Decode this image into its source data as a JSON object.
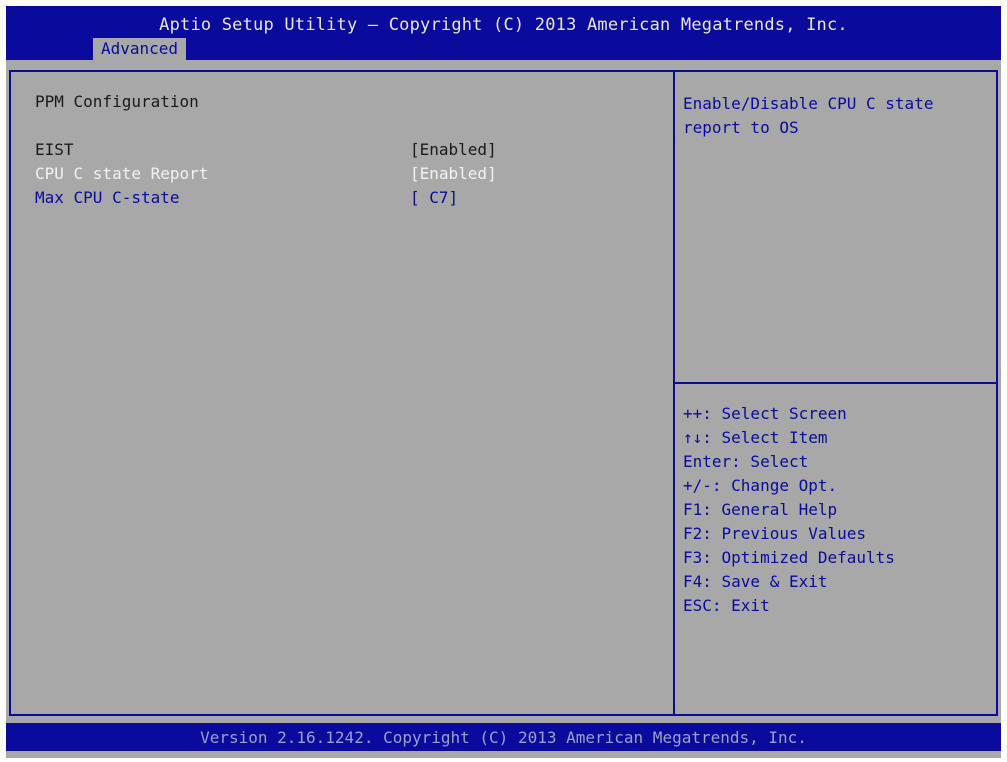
{
  "header": {
    "title": "Aptio Setup Utility – Copyright (C) 2013 American Megatrends, Inc.",
    "active_tab": "Advanced"
  },
  "main": {
    "section_title": "PPM Configuration",
    "settings": [
      {
        "label": "EIST",
        "value": "[Enabled]"
      },
      {
        "label": "CPU C state Report",
        "value": "[Enabled]"
      },
      {
        "label": "Max CPU C-state",
        "value": "[ C7]"
      }
    ]
  },
  "help": {
    "description": "Enable/Disable CPU C state report to OS",
    "keys": [
      "++: Select Screen",
      "↑↓: Select Item",
      "Enter: Select",
      "+/-: Change Opt.",
      "F1: General Help",
      "F2: Previous Values",
      "F3: Optimized Defaults",
      "F4: Save & Exit",
      "ESC: Exit"
    ]
  },
  "footer": {
    "version": "Version 2.16.1242. Copyright (C) 2013 American Megatrends, Inc."
  },
  "colors": {
    "header_bg": "#0a0a9c",
    "panel_bg": "#a8a8a8",
    "highlight_text": "#f2f2f2"
  }
}
